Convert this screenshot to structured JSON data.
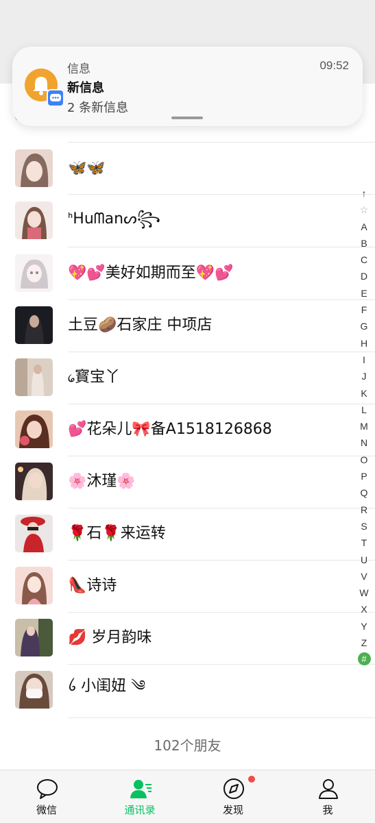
{
  "notification": {
    "app": "信息",
    "time": "09:52",
    "title": "新信息",
    "body": "2 条新信息"
  },
  "contacts": [
    {
      "name": ""
    },
    {
      "name": "🦋🦋"
    },
    {
      "name": "ᑋHuᗰanᔕ꧂"
    },
    {
      "name": "💖💕美好如期而至💖💕"
    },
    {
      "name": "      土豆🥔石家庄 中项店"
    },
    {
      "name": "᥀寳宝丫"
    },
    {
      "name": "💕花朵儿🎀备A1518126868"
    },
    {
      "name": "🌸沐瑾🌸"
    },
    {
      "name": "🌹石🌹来运转"
    },
    {
      "name": "👠诗诗"
    },
    {
      "name": "💋 岁月韵味"
    },
    {
      "name": "ꪉ 小闺妞 ༄"
    }
  ],
  "index": [
    "↑",
    "☆",
    "A",
    "B",
    "C",
    "D",
    "E",
    "F",
    "G",
    "H",
    "I",
    "J",
    "K",
    "L",
    "M",
    "N",
    "O",
    "P",
    "Q",
    "R",
    "S",
    "T",
    "U",
    "V",
    "W",
    "X",
    "Y",
    "Z",
    "#"
  ],
  "friend_count": "102个朋友",
  "tabs": [
    {
      "label": "微信",
      "icon": "chat-bubble-icon"
    },
    {
      "label": "通讯录",
      "icon": "contacts-icon"
    },
    {
      "label": "发现",
      "icon": "compass-icon"
    },
    {
      "label": "我",
      "icon": "person-icon"
    }
  ],
  "colors": {
    "accent": "#07c160",
    "badge_dot": "#f24a4a",
    "bell": "#f0a32e"
  }
}
